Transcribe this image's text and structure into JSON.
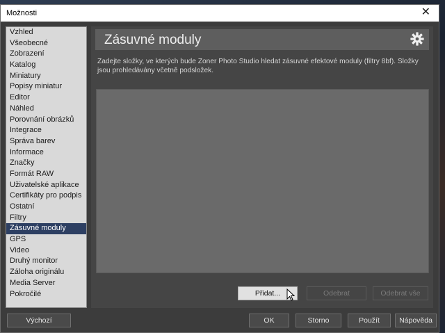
{
  "window": {
    "title": "Možnosti",
    "close_glyph": "✕"
  },
  "sidebar": {
    "items": [
      {
        "label": "Vzhled"
      },
      {
        "label": "Všeobecné"
      },
      {
        "label": "Zobrazení"
      },
      {
        "label": "Katalog"
      },
      {
        "label": "Miniatury"
      },
      {
        "label": "Popisy miniatur"
      },
      {
        "label": "Editor"
      },
      {
        "label": "Náhled"
      },
      {
        "label": "Porovnání obrázků"
      },
      {
        "label": "Integrace"
      },
      {
        "label": "Správa barev"
      },
      {
        "label": "Informace"
      },
      {
        "label": "Značky"
      },
      {
        "label": "Formát RAW"
      },
      {
        "label": "Uživatelské aplikace"
      },
      {
        "label": "Certifikáty pro podpis"
      },
      {
        "label": "Ostatní"
      },
      {
        "label": "Filtry"
      },
      {
        "label": "Zásuvné moduly"
      },
      {
        "label": "GPS"
      },
      {
        "label": "Video"
      },
      {
        "label": "Druhý monitor"
      },
      {
        "label": "Záloha originálu"
      },
      {
        "label": "Media Server"
      },
      {
        "label": "Pokročilé"
      }
    ],
    "selected": "Zásuvné moduly"
  },
  "panel": {
    "title": "Zásuvné moduly",
    "settings_icon": "gear-icon",
    "description": "Zadejte složky, ve kterých bude Zoner Photo Studio hledat zásuvné efektové moduly (filtry 8bf). Složky jsou prohledávány včetně podsložek.",
    "folders": [],
    "buttons": {
      "add": "Přidat...",
      "remove": "Odebrat",
      "remove_all": "Odebrat vše"
    }
  },
  "footer": {
    "default": "Výchozí",
    "ok": "OK",
    "cancel": "Storno",
    "apply": "Použít",
    "help": "Nápověda"
  },
  "colors": {
    "selection": "#2d3f62",
    "dialog_bg": "#3c3c3c",
    "panel_bg": "#454545",
    "header_bg": "#5e5e5e",
    "list_bg": "#6a6a6a"
  }
}
